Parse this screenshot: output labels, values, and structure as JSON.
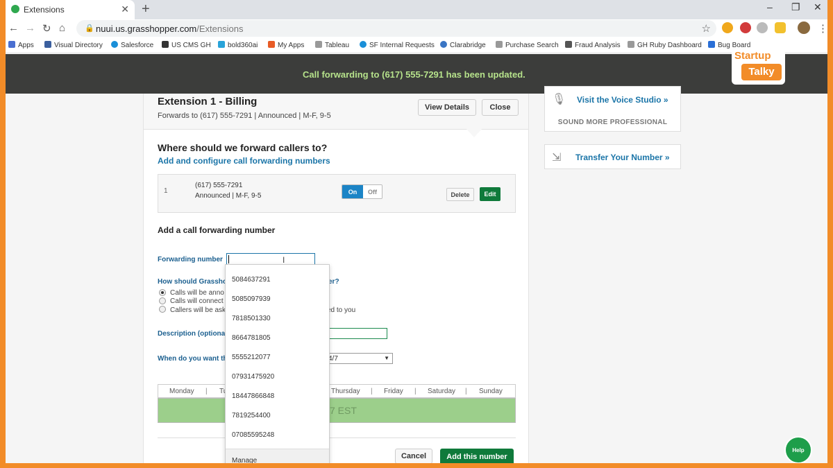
{
  "browser": {
    "tab_title": "Extensions",
    "new_tab": "+",
    "close_tab": "✕",
    "url_host": "nuui.us.grasshopper.com",
    "url_path": "/Extensions",
    "bookmarks": [
      "Apps",
      "Visual Directory",
      "Salesforce",
      "US CMS GH",
      "bold360ai",
      "My Apps",
      "Tableau",
      "SF Internal Requests",
      "Clarabridge",
      "Purchase Search",
      "Fraud Analysis",
      "GH Ruby Dashboard",
      "Bug Board"
    ],
    "bookmark_colors": [
      "#4a6fd1",
      "#3b5f9e",
      "#1a8fd8",
      "#333333",
      "#29a3d9",
      "#e85c26",
      "#999999",
      "#1a8fd8",
      "#3a75c4",
      "#999999",
      "#555555",
      "#999999",
      "#2a6fd6"
    ]
  },
  "notification": "Call forwarding to (617) 555-7291 has been updated.",
  "extension": {
    "title": "Extension 1 - Billing",
    "subtitle": "Forwards to (617) 555-7291 | Announced | M-F, 9-5",
    "view_details": "View Details",
    "close": "Close"
  },
  "forward": {
    "question": "Where should we forward callers to?",
    "add_link": "Add and configure call forwarding numbers",
    "index": "1",
    "number": "(617) 555-7291",
    "details": "Announced  |  M-F, 9-5",
    "toggle_on": "On",
    "toggle_off": "Off",
    "delete": "Delete",
    "edit": "Edit"
  },
  "form": {
    "heading": "Add a call forwarding number",
    "forwarding_label": "Forwarding number",
    "how_label": "How should Grassho",
    "how_label_tail": "er?",
    "radio1": "Calls will be anno",
    "radio2": "Calls will connect",
    "radio3": "Callers will be ask",
    "radio3_tail": "ed to you",
    "desc_label": "Description (optiona",
    "when_label": "When do you want th",
    "schedule_value": "4/7",
    "days": [
      "Monday",
      "Tu",
      "Thursday",
      "Friday",
      "Saturday",
      "Sunday"
    ],
    "schedule_text": "7 EST",
    "cancel": "Cancel",
    "add_number": "Add this number"
  },
  "autocomplete": {
    "items": [
      "5084637291",
      "5085097939",
      "7818501330",
      "8664781805",
      "5555212077",
      "07931475920",
      "18447866848",
      "7819254400",
      "07085595248"
    ],
    "manage": "Manage"
  },
  "sidebar": {
    "voice_studio": "Visit the Voice Studio »",
    "voice_sub": "SOUND MORE PROFESSIONAL",
    "transfer": "Transfer Your Number »"
  },
  "watermark": {
    "line1": "Startup",
    "line2": "Talky"
  },
  "help": "Help"
}
